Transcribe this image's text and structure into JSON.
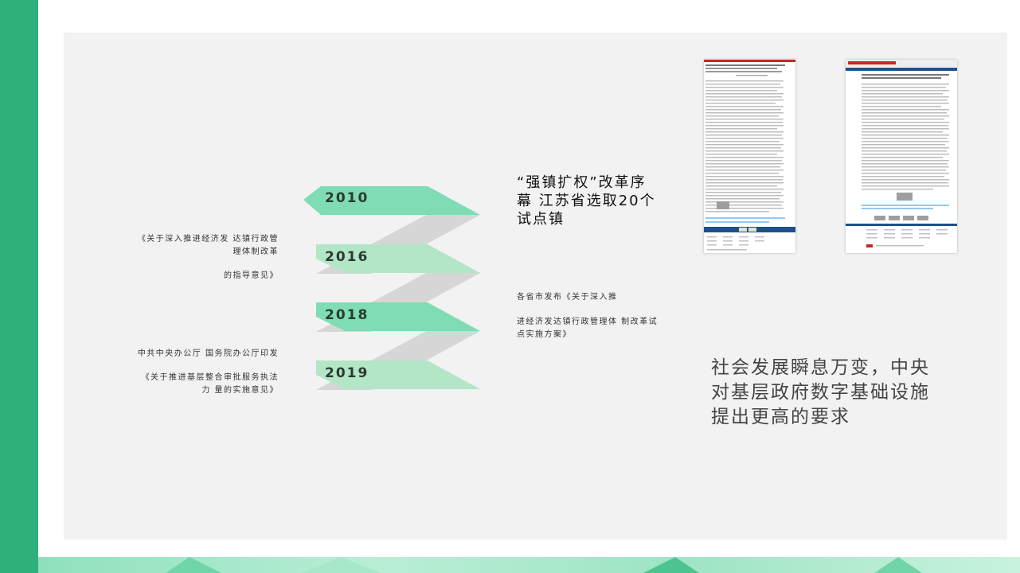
{
  "timeline": {
    "years": [
      "2010",
      "2016",
      "2018",
      "2019"
    ],
    "left_notes": {
      "note_2016_line1": "《关于深入推进经济发 达镇行政管",
      "note_2016_line2": "理体制改革",
      "note_2016_line3": "的指导意见》",
      "note_2019_line1": "中共中央办公厅 国务院办公厅印发",
      "note_2019_line2": "《关于推进基层整合审批服务执法",
      "note_2019_line3": "力 量的实施意见》"
    },
    "right_notes": {
      "note_2010_line1": "“强镇扩权”改革序",
      "note_2010_line2": "幕 江苏省选取20个",
      "note_2010_line3": "试点镇",
      "note_2018_line1": "各省市发布《关于深入推",
      "note_2018_line2": "进经济发达镇行政管理体 制改革试",
      "note_2018_line3": "点实施方案》"
    }
  },
  "summary": {
    "line1": "社会发展瞬息万变，中央",
    "line2": "对基层政府数字基础设施",
    "line3": "提出更高的要求"
  },
  "colors": {
    "accent_green": "#2fb07a",
    "arrow_dark": "#7fdcb4",
    "arrow_light": "#b3e5c7",
    "connector_gray": "#d6d6d6",
    "panel_bg": "#f2f2f2"
  }
}
